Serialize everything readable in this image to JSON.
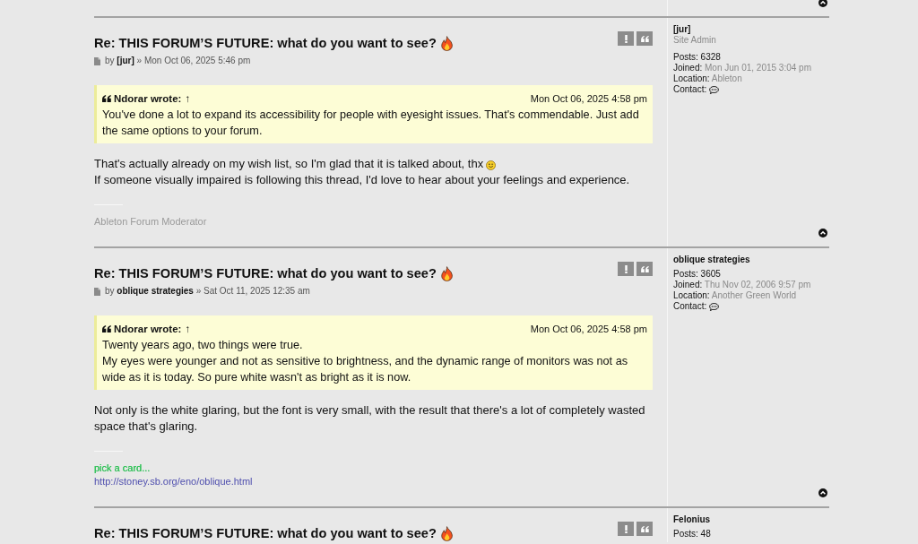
{
  "posts": [
    {
      "title": "Re: THIS FORUM’S FUTURE: what do you want to see?",
      "byline": {
        "prefix": "by",
        "author": "[jur]",
        "separator": "»",
        "date": "Mon Oct 06, 2025 5:46 pm"
      },
      "quote": {
        "author": "Ndorar wrote:",
        "jump": "↑",
        "date": "Mon Oct 06, 2025 4:58 pm",
        "lines": [
          "You've done a lot to expand its accessibility for people with eyesight issues. That's commendable. Just add the same options to your forum."
        ]
      },
      "body": [
        {
          "text": "That's actually already on my wish list, so I'm glad that it is talked about, thx",
          "smiley": true
        },
        {
          "text": "If someone visually impaired is following this thread, I'd love to hear about your feelings and experience.",
          "smiley": false
        }
      ],
      "signature": [
        {
          "kind": "muted",
          "text": "Ableton Forum Moderator"
        }
      ],
      "profile": {
        "name": "[jur]",
        "rank": "Site Admin",
        "stats": [
          {
            "kind": "count",
            "label": "Posts:",
            "value": "6328"
          },
          {
            "kind": "detail",
            "label": "Joined:",
            "value": "Mon Jun 01, 2015 3:04 pm"
          },
          {
            "kind": "detail",
            "label": "Location:",
            "value": "Ableton"
          }
        ],
        "contact": "Contact:"
      }
    },
    {
      "title": "Re: THIS FORUM’S FUTURE: what do you want to see?",
      "byline": {
        "prefix": "by",
        "author": "oblique strategies",
        "separator": "»",
        "date": "Sat Oct 11, 2025 12:35 am"
      },
      "quote": {
        "author": "Ndorar wrote:",
        "jump": "↑",
        "date": "Mon Oct 06, 2025 4:58 pm",
        "lines": [
          "Twenty years ago, two things were true.",
          "My eyes were younger and not as sensitive to brightness, and the dynamic range of monitors was not as wide as it is today. So pure white wasn't as bright as it is now."
        ]
      },
      "body": [
        {
          "text": "Not only is the white glaring, but the font is very small, with the result that there's a lot of completely wasted space that's glaring.",
          "smiley": false
        }
      ],
      "signature": [
        {
          "kind": "colored",
          "color": "#33c25a",
          "text": "pick a card..."
        },
        {
          "kind": "link",
          "text": "http://stoney.sb.org/eno/oblique.html"
        }
      ],
      "profile": {
        "name": "oblique strategies",
        "stats": [
          {
            "kind": "count",
            "label": "Posts:",
            "value": "3605"
          },
          {
            "kind": "detail",
            "label": "Joined:",
            "value": "Thu Nov 02, 2006 9:57 pm"
          },
          {
            "kind": "detail",
            "label": "Location:",
            "value": "Another Green World"
          }
        ],
        "contact": "Contact:"
      }
    },
    {
      "title": "Re: THIS FORUM’S FUTURE: what do you want to see?",
      "profile": {
        "name": "Felonius",
        "stats": [
          {
            "kind": "count",
            "label": "Posts:",
            "value": "48"
          }
        ]
      }
    }
  ]
}
